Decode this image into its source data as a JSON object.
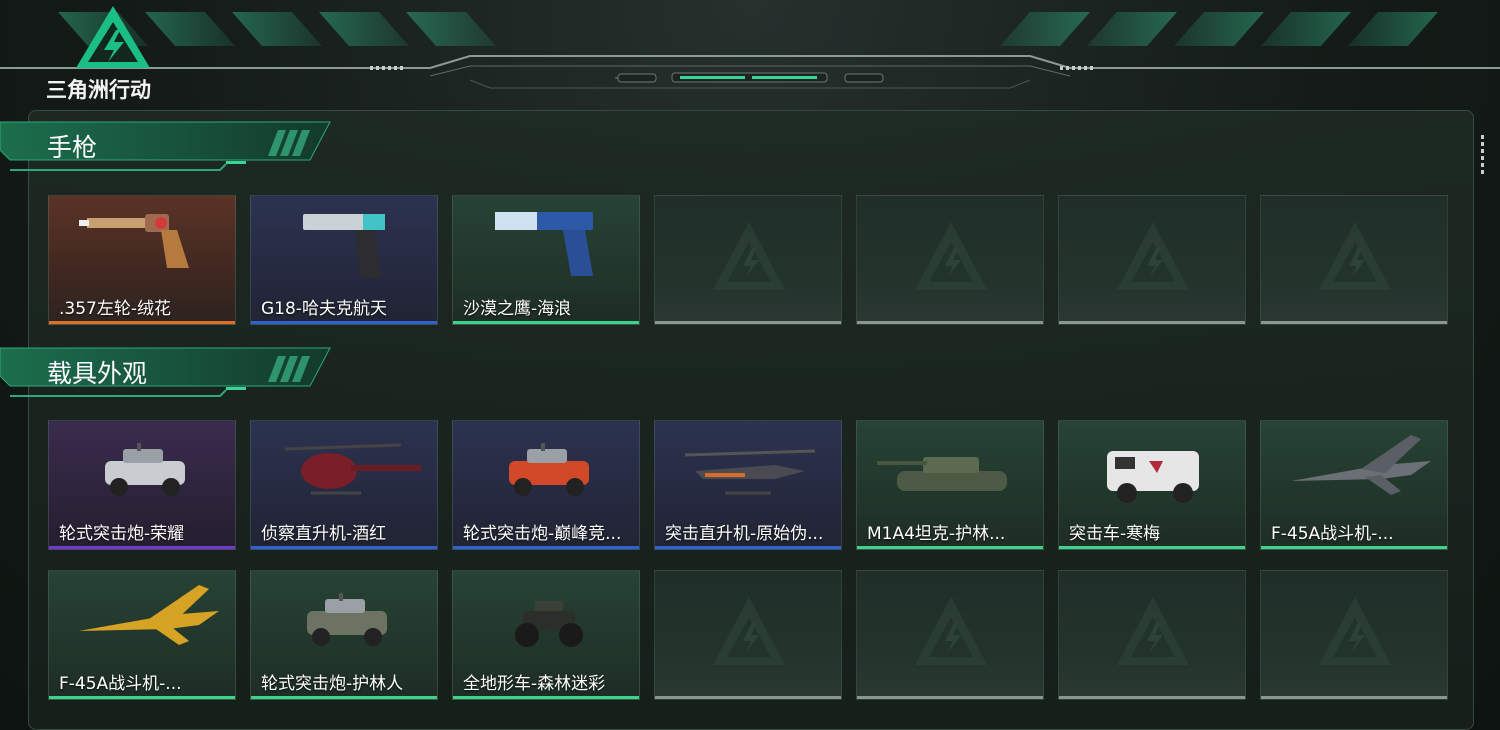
{
  "app": {
    "logo_text": "三角洲行动"
  },
  "colors": {
    "orange": "#d9722d",
    "blue": "#2d63d1",
    "green": "#3ed38c",
    "purple": "#6e3bd1",
    "empty": "#8c9691"
  },
  "sections": [
    {
      "title": "手枪",
      "items": [
        {
          "label": ".357左轮-绒花",
          "rarity": "orange",
          "icon": "revolver-icon"
        },
        {
          "label": "G18-哈夫克航天",
          "rarity": "blue",
          "icon": "pistol-icon"
        },
        {
          "label": "沙漠之鹰-海浪",
          "rarity": "green",
          "icon": "desert-eagle-icon"
        }
      ]
    },
    {
      "title": "载具外观",
      "items": [
        {
          "label": "轮式突击炮-荣耀",
          "rarity": "purple",
          "icon": "armored-car-icon"
        },
        {
          "label": "侦察直升机-酒红",
          "rarity": "blue",
          "icon": "helicopter-icon"
        },
        {
          "label": "轮式突击炮-巅峰竞...",
          "rarity": "blue",
          "icon": "armored-car-icon"
        },
        {
          "label": "突击直升机-原始伪...",
          "rarity": "blue",
          "icon": "attack-helicopter-icon"
        },
        {
          "label": "M1A4坦克-护林...",
          "rarity": "green",
          "icon": "tank-icon"
        },
        {
          "label": "突击车-寒梅",
          "rarity": "green",
          "icon": "assault-vehicle-icon"
        },
        {
          "label": "F-45A战斗机-...",
          "rarity": "green",
          "icon": "fighter-jet-icon"
        },
        {
          "label": "F-45A战斗机-...",
          "rarity": "green",
          "icon": "fighter-jet-icon"
        },
        {
          "label": "轮式突击炮-护林人",
          "rarity": "green",
          "icon": "armored-car-icon"
        },
        {
          "label": "全地形车-森林迷彩",
          "rarity": "green",
          "icon": "atv-icon"
        }
      ]
    }
  ]
}
